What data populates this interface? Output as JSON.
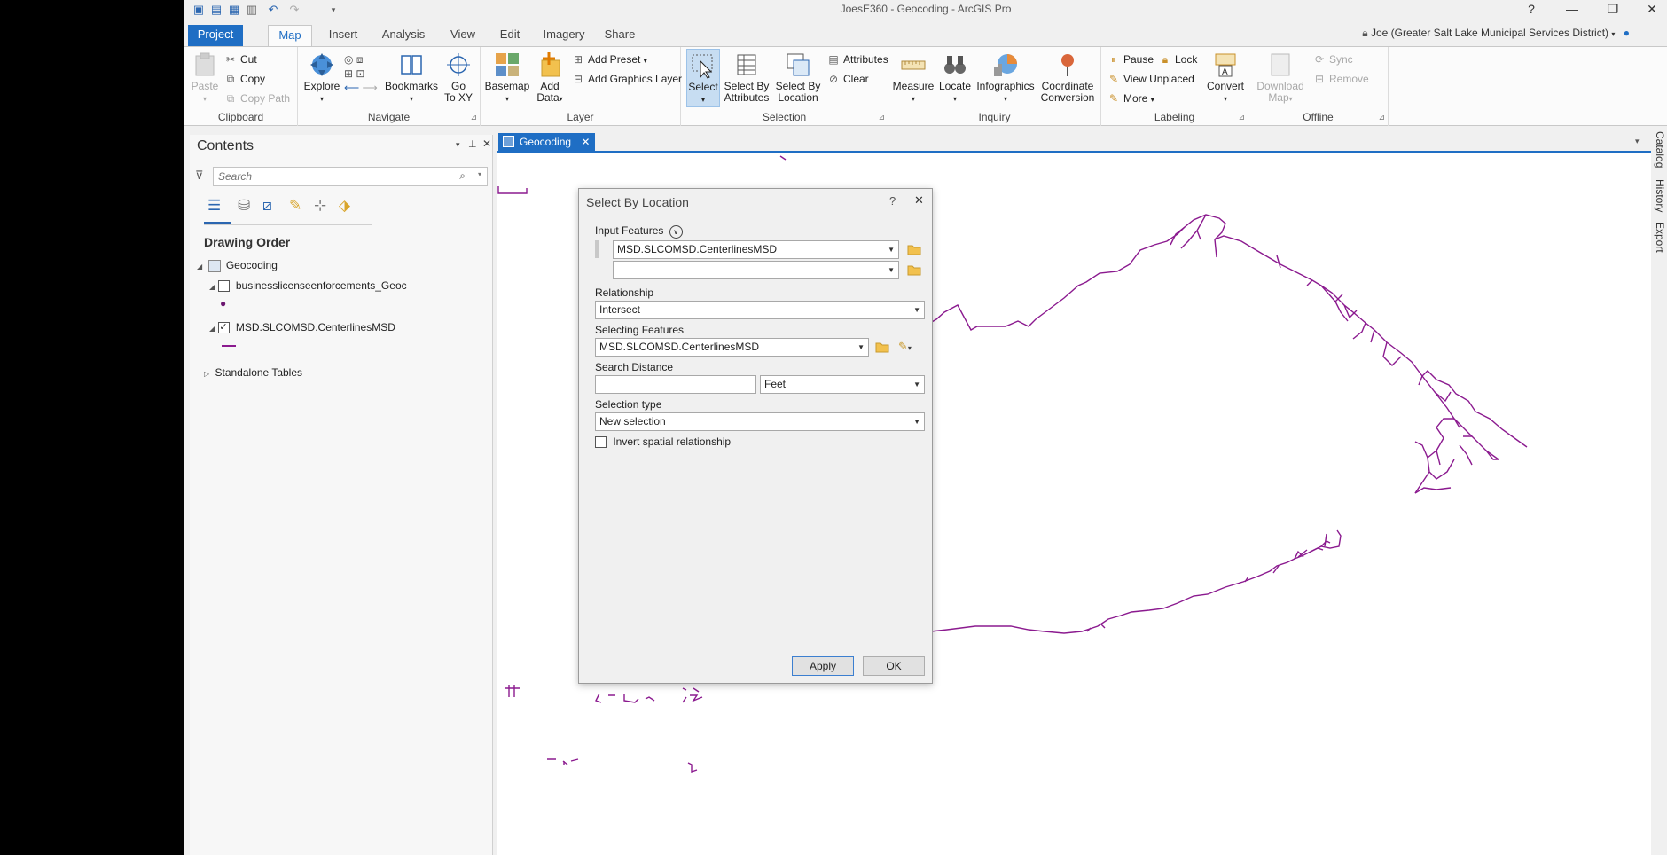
{
  "window": {
    "title": "JoesE360 - Geocoding - ArcGIS Pro",
    "help": "?",
    "minimize": "—",
    "restore": "❐",
    "close": "✕"
  },
  "tabs": {
    "project": "Project",
    "map": "Map",
    "insert": "Insert",
    "analysis": "Analysis",
    "view": "View",
    "edit": "Edit",
    "imagery": "Imagery",
    "share": "Share"
  },
  "user": "Joe (Greater Salt Lake Municipal Services District)",
  "ribbon": {
    "clipboard": {
      "label": "Clipboard",
      "paste": "Paste",
      "cut": "Cut",
      "copy": "Copy",
      "copy_path": "Copy Path"
    },
    "navigate": {
      "label": "Navigate",
      "explore": "Explore",
      "bookmarks": "Bookmarks",
      "go_to_xy_1": "Go",
      "go_to_xy_2": "To XY"
    },
    "layer": {
      "label": "Layer",
      "basemap": "Basemap",
      "add_data_1": "Add",
      "add_data_2": "Data",
      "add_preset": "Add Preset",
      "add_graphics_layer": "Add Graphics Layer"
    },
    "selection": {
      "label": "Selection",
      "select": "Select",
      "select_by_attributes_1": "Select By",
      "select_by_attributes_2": "Attributes",
      "select_by_location_1": "Select By",
      "select_by_location_2": "Location",
      "attributes": "Attributes",
      "clear": "Clear"
    },
    "inquiry": {
      "label": "Inquiry",
      "measure": "Measure",
      "locate": "Locate",
      "infographics": "Infographics",
      "coordinate_conversion_1": "Coordinate",
      "coordinate_conversion_2": "Conversion"
    },
    "labeling": {
      "label": "Labeling",
      "pause": "Pause",
      "lock": "Lock",
      "view_unplaced": "View Unplaced",
      "more": "More",
      "convert": "Convert"
    },
    "offline": {
      "label": "Offline",
      "download_map_1": "Download",
      "download_map_2": "Map",
      "sync": "Sync",
      "remove": "Remove"
    }
  },
  "contents": {
    "title": "Contents",
    "search_placeholder": "Search",
    "drawing_order": "Drawing Order",
    "map_name": "Geocoding",
    "layer1": "businesslicenseenforcements_Geoc",
    "layer1_checked": false,
    "layer2": "MSD.SLCOMSD.CenterlinesMSD",
    "layer2_checked": true,
    "standalone": "Standalone Tables"
  },
  "map_tab": "Geocoding",
  "side_tabs": [
    "Catalog",
    "History",
    "Export"
  ],
  "dialog": {
    "title": "Select By Location",
    "help": "?",
    "input_features_label": "Input Features",
    "input_feature_1": "MSD.SLCOMSD.CenterlinesMSD",
    "input_feature_2": "",
    "relationship_label": "Relationship",
    "relationship": "Intersect",
    "selecting_features_label": "Selecting Features",
    "selecting_features": "MSD.SLCOMSD.CenterlinesMSD",
    "search_distance_label": "Search Distance",
    "search_distance": "",
    "search_distance_unit": "Feet",
    "selection_type_label": "Selection type",
    "selection_type": "New selection",
    "invert_label": "Invert spatial relationship",
    "invert_checked": false,
    "apply": "Apply",
    "ok": "OK"
  },
  "colors": {
    "accent": "#1f6ec4",
    "feature_line": "#8b1a8f",
    "selected_line": "#33b8e8"
  }
}
